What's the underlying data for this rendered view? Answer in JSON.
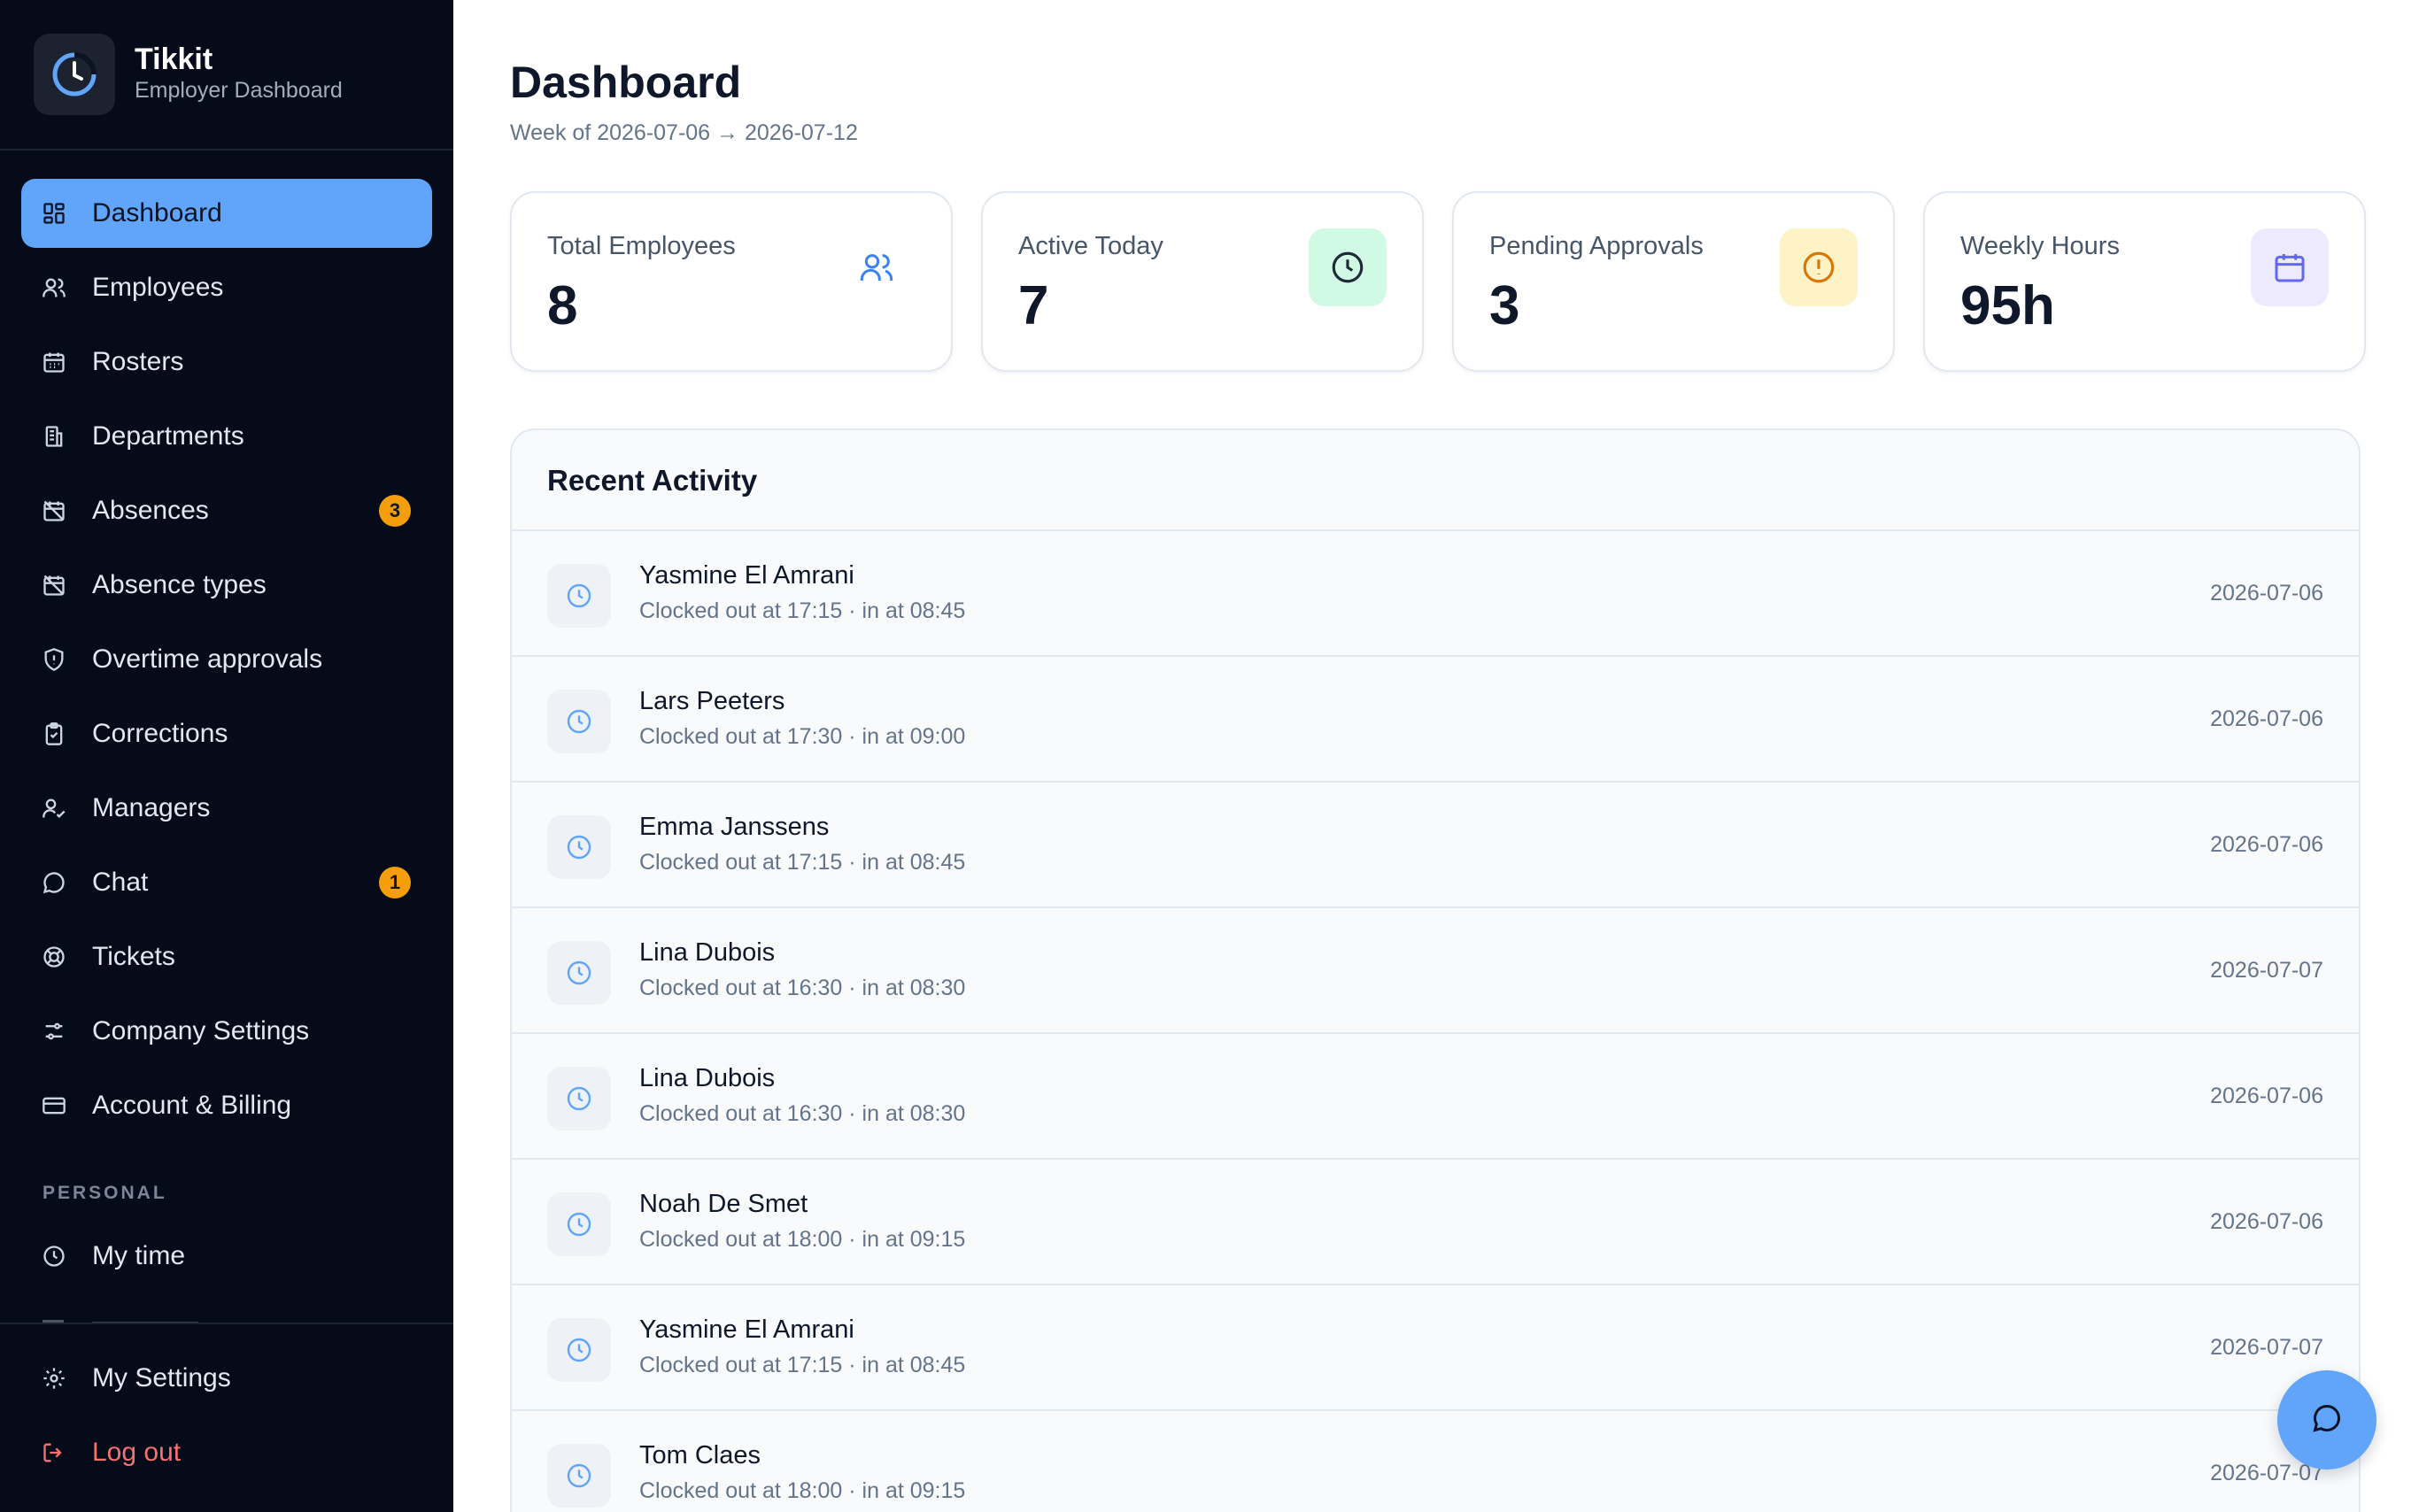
{
  "app": {
    "name": "Tikkit",
    "subtitle": "Employer Dashboard",
    "logo_icon": "clock-logo-icon"
  },
  "sidebar": {
    "items": [
      {
        "label": "Dashboard",
        "icon": "grid-icon",
        "active": true
      },
      {
        "label": "Employees",
        "icon": "users-icon"
      },
      {
        "label": "Rosters",
        "icon": "calendar-grid-icon"
      },
      {
        "label": "Departments",
        "icon": "building-icon"
      },
      {
        "label": "Absences",
        "icon": "calendar-off-icon",
        "badge": "3"
      },
      {
        "label": "Absence types",
        "icon": "calendar-off-icon"
      },
      {
        "label": "Overtime approvals",
        "icon": "shield-alert-icon"
      },
      {
        "label": "Corrections",
        "icon": "clipboard-check-icon"
      },
      {
        "label": "Managers",
        "icon": "user-check-icon"
      },
      {
        "label": "Chat",
        "icon": "chat-icon",
        "badge": "1"
      },
      {
        "label": "Tickets",
        "icon": "lifebuoy-icon"
      },
      {
        "label": "Company Settings",
        "icon": "sliders-icon"
      },
      {
        "label": "Account & Billing",
        "icon": "credit-card-icon"
      }
    ],
    "personal_title": "PERSONAL",
    "personal_items": [
      {
        "label": "My time",
        "icon": "clock-icon"
      }
    ],
    "bottom_items": [
      {
        "label": "My Settings",
        "icon": "gear-icon"
      },
      {
        "label": "Log out",
        "icon": "logout-icon"
      }
    ]
  },
  "header": {
    "title": "Dashboard",
    "week": "Week of 2026-07-06 → 2026-07-12"
  },
  "stats": [
    {
      "label": "Total Employees",
      "value": "8",
      "icon": "users-icon",
      "color": "#3b82f6",
      "bg": "#ffffff"
    },
    {
      "label": "Active Today",
      "value": "7",
      "icon": "clock-icon",
      "color": "#1f2937",
      "bg": "#d1fae5"
    },
    {
      "label": "Pending Approvals",
      "value": "3",
      "icon": "alert-circle-icon",
      "color": "#d97706",
      "bg": "#fef3c7"
    },
    {
      "label": "Weekly Hours",
      "value": "95h",
      "icon": "calendar-icon",
      "color": "#6366f1",
      "bg": "#ede9fe"
    }
  ],
  "activity": {
    "title": "Recent Activity",
    "rows": [
      {
        "name": "Yasmine El Amrani",
        "detail": "Clocked out at 17:15 · in at 08:45",
        "date": "2026-07-06"
      },
      {
        "name": "Lars Peeters",
        "detail": "Clocked out at 17:30 · in at 09:00",
        "date": "2026-07-06"
      },
      {
        "name": "Emma Janssens",
        "detail": "Clocked out at 17:15 · in at 08:45",
        "date": "2026-07-06"
      },
      {
        "name": "Lina Dubois",
        "detail": "Clocked out at 16:30 · in at 08:30",
        "date": "2026-07-07"
      },
      {
        "name": "Lina Dubois",
        "detail": "Clocked out at 16:30 · in at 08:30",
        "date": "2026-07-06"
      },
      {
        "name": "Noah De Smet",
        "detail": "Clocked out at 18:00 · in at 09:15",
        "date": "2026-07-06"
      },
      {
        "name": "Yasmine El Amrani",
        "detail": "Clocked out at 17:15 · in at 08:45",
        "date": "2026-07-07"
      },
      {
        "name": "Tom Claes",
        "detail": "Clocked out at 18:00 · in at 09:15",
        "date": "2026-07-07"
      }
    ]
  },
  "fab": {
    "icon": "chat-icon"
  }
}
